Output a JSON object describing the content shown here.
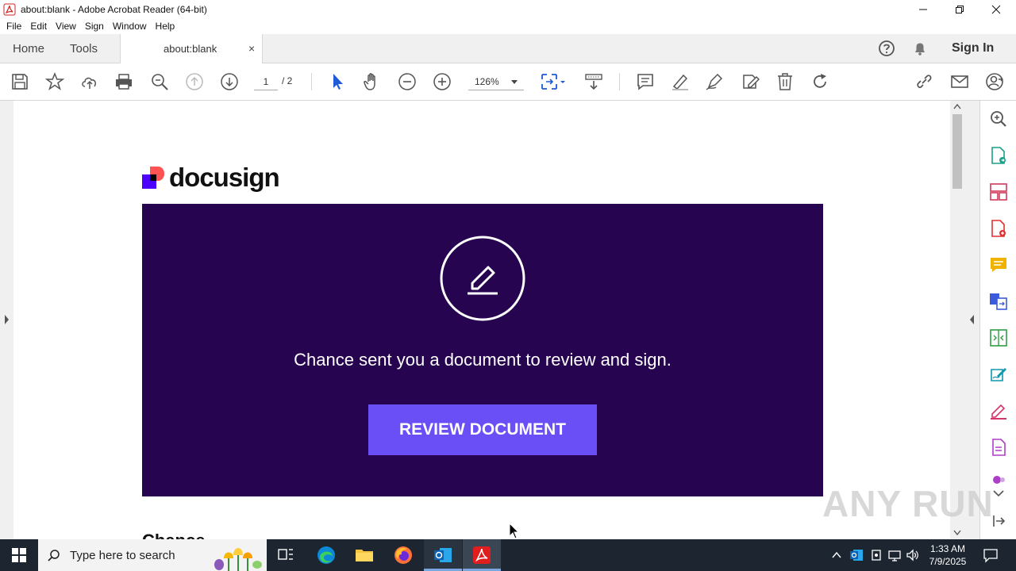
{
  "window": {
    "title": "about:blank - Adobe Acrobat Reader (64-bit)"
  },
  "menu": [
    "File",
    "Edit",
    "View",
    "Sign",
    "Window",
    "Help"
  ],
  "tabs": {
    "home": "Home",
    "tools": "Tools",
    "document_tab": "about:blank",
    "close_glyph": "×",
    "sign_in": "Sign In"
  },
  "toolbar": {
    "current_page": "1",
    "total_pages": "/ 2",
    "zoom": "126%"
  },
  "document": {
    "brand": "docusign",
    "message": "Chance sent you a document to review and sign.",
    "button": "REVIEW DOCUMENT",
    "sender_partial": "Chance",
    "banner_color": "#26044f",
    "button_color": "#6a4ff7"
  },
  "watermark": "ANY RUN",
  "taskbar": {
    "search_placeholder": "Type here to search",
    "time": "1:33 AM",
    "date": "7/9/2025"
  },
  "icons": {
    "toolbar": [
      "save-icon",
      "bookmark-star-icon",
      "upload-cloud-icon",
      "print-icon",
      "zoom-search-icon",
      "page-up-icon",
      "page-down-icon",
      "select-cursor-icon",
      "hand-icon",
      "zoom-out-icon",
      "zoom-in-icon",
      "fit-page-icon",
      "scroll-mode-icon",
      "comment-icon",
      "highlight-icon",
      "draw-pen-icon",
      "edit-icon",
      "delete-icon",
      "rotate-icon",
      "link-icon",
      "email-icon",
      "share-user-icon"
    ],
    "right_panel": [
      "search-zoom-icon",
      "export-pdf-icon",
      "organize-icon",
      "create-pdf-icon",
      "comment-icon",
      "combine-icon",
      "compress-icon",
      "fill-sign-icon",
      "redact-icon",
      "protect-icon",
      "more-chevron-icon",
      "collapse-panel-icon"
    ]
  }
}
